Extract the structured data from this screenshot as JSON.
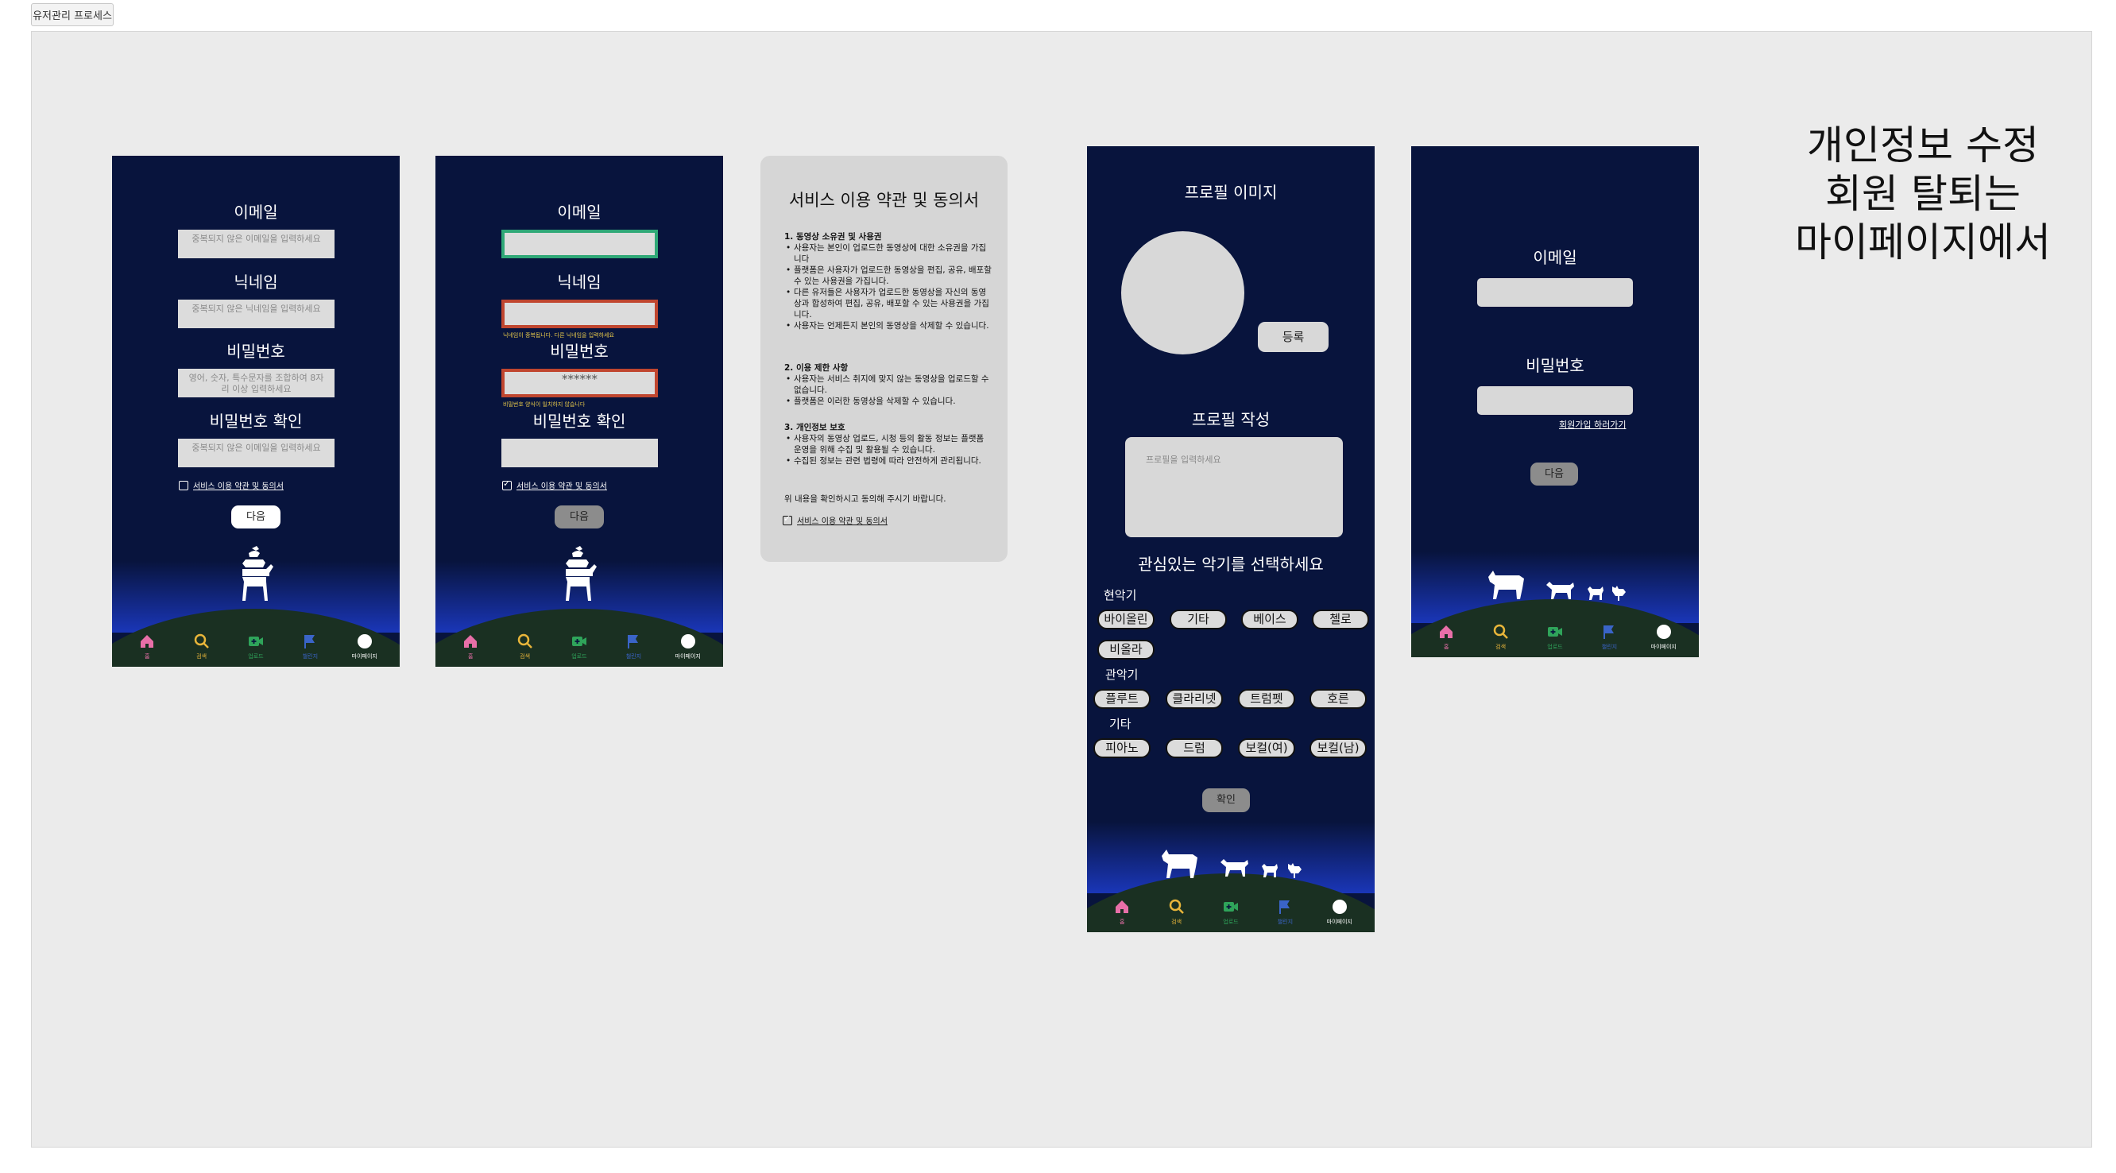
{
  "top_tab": "유저관리 프로세스",
  "screen1": {
    "email_label": "이메일",
    "email_placeholder": "중복되지 않은 이메일을 입력하세요",
    "nickname_label": "닉네임",
    "nickname_placeholder": "중복되지 않은 닉네임을 입력하세요",
    "password_label": "비밀번호",
    "password_placeholder_1": "영어, 숫자, 특수문자를 조합하여 8자",
    "password_placeholder_2": "리 이상 입력하세요",
    "confirm_label": "비밀번호 확인",
    "confirm_placeholder": "중복되지 않은 이메일을 입력하세요",
    "agree_label": "서비스 이용 약관 및 동의서",
    "next_button": "다음"
  },
  "screen2": {
    "email_label": "이메일",
    "nickname_label": "닉네임",
    "nickname_error": "닉네임이 중복됩니다. 다른 닉네임을 입력하세요",
    "password_label": "비밀번호",
    "password_value": "******",
    "password_error": "비밀번호 양식이 일치하지 않습니다",
    "confirm_label": "비밀번호 확인",
    "agree_label": "서비스 이용 약관 및 동의서",
    "next_button": "다음"
  },
  "terms": {
    "title": "서비스 이용 약관 및 동의서",
    "s1_title": "1. 동영상 소유권 및 사용권",
    "s1_items": [
      "사용자는 본인이 업로드한 동영상에 대한 소유권을 가집니다",
      "플랫폼은 사용자가 업로드한 동영상을 편집, 공유, 배포할 수 있는 사용권을 가집니다.",
      "다른 유저들은 사용자가 업로드한 동영상을 자신의 동영상과 합성하여 편집, 공유, 배포할 수 있는 사용권을 가집니다.",
      "사용자는 언제든지 본인의 동영상을 삭제할 수 있습니다."
    ],
    "s2_title": "2. 이용 제한 사항",
    "s2_items": [
      "사용자는 서비스 취지에 맞지 않는 동영상을 업로드할 수 없습니다.",
      "플랫폼은 이러한 동영상을 삭제할 수 있습니다."
    ],
    "s3_title": "3. 개인정보 보호",
    "s3_items": [
      "사용자의 동영상 업로드, 시청 등의 활동 정보는 플랫폼 운영을 위해 수집 및 활용될 수 있습니다.",
      "수집된 정보는 관련 법령에 따라 안전하게 관리됩니다."
    ],
    "footer": "위 내용을 확인하시고 동의해 주시기 바랍니다.",
    "agree_label": "서비스 이용 약관 및 동의서"
  },
  "profile": {
    "image_label": "프로필 이미지",
    "register_button": "등록",
    "write_label": "프로필 작성",
    "write_placeholder": "프로필을 입력하세요",
    "instrument_title": "관심있는 악기를 선택하세요",
    "cat_strings": "현악기",
    "cat_wind": "관악기",
    "cat_other": "기타",
    "strings": [
      "바이올린",
      "기타",
      "베이스",
      "첼로",
      "비올라"
    ],
    "wind": [
      "플루트",
      "클라리넷",
      "트럼펫",
      "호른"
    ],
    "other": [
      "피아노",
      "드럼",
      "보컬(여)",
      "보컬(남)"
    ],
    "confirm_button": "확인"
  },
  "login": {
    "email_label": "이메일",
    "password_label": "비밀번호",
    "signup_link": "회원가입 하러가기",
    "next_button": "다음"
  },
  "nav": {
    "home": "홈",
    "search": "검색",
    "upload": "업로드",
    "challenge": "챌린지",
    "mypage": "마이페이지",
    "colors": {
      "home": "#e86fa8",
      "search": "#e8b53a",
      "upload": "#2fa45a",
      "challenge": "#3a64c8",
      "mypage": "#ffffff"
    }
  },
  "note": {
    "line1": "개인정보 수정",
    "line2": "회원 탈퇴는",
    "line3": "마이페이지에서"
  }
}
